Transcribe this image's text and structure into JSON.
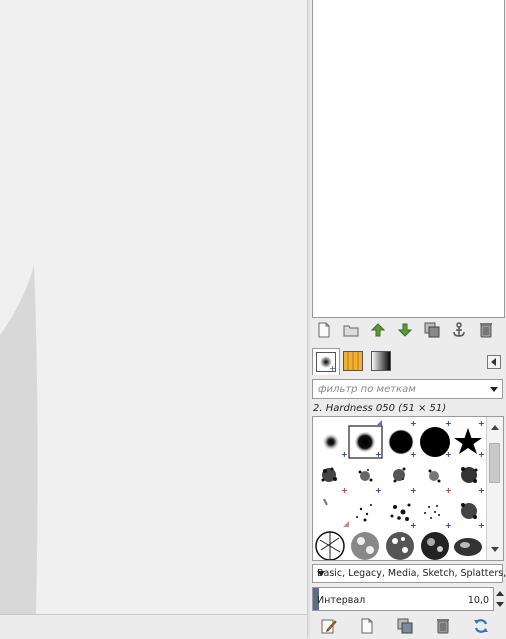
{
  "brushes": {
    "filter_placeholder": "фильтр по меткам",
    "selected_brush": "2. Hardness 050 (51 × 51)",
    "tags_value": "Basic, Legacy, Media, Sketch, Splatters,",
    "spacing_label": "Интервал",
    "spacing_value": "10,0"
  },
  "icons": {
    "layers_toolbar": [
      "new-layer-icon",
      "new-group-icon",
      "raise-layer-icon",
      "lower-layer-icon",
      "duplicate-layer-icon",
      "anchor-layer-icon",
      "delete-layer-icon"
    ],
    "tabs": [
      "brushes-tab-icon",
      "patterns-tab-icon",
      "gradients-tab-icon"
    ],
    "bottom_toolbar": [
      "edit-brush-icon",
      "new-brush-icon",
      "duplicate-brush-icon",
      "delete-brush-icon",
      "refresh-brushes-icon"
    ]
  },
  "colors": {
    "canvas_bg": "#f0f0f0",
    "canvas_shape": "#d8d8d8",
    "arrow_green": "#5a9a3a",
    "delete_gray": "#7a7a7a",
    "refresh_blue": "#3a70c0"
  }
}
